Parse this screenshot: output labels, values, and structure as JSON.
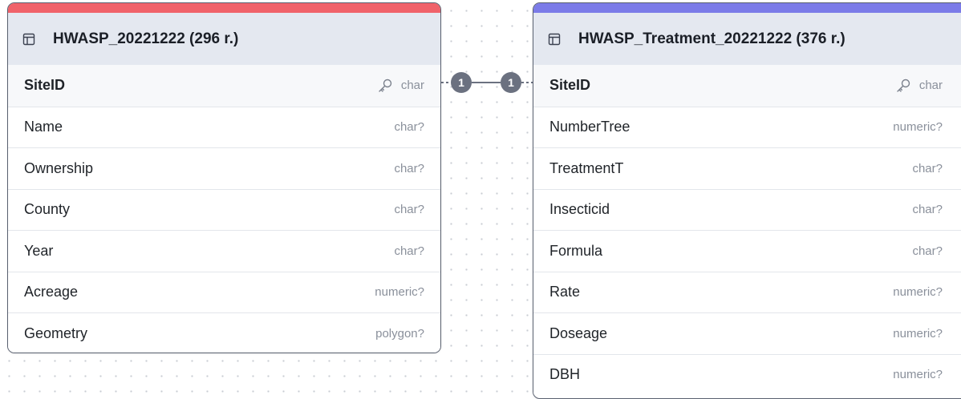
{
  "colors": {
    "left_accent": "#f0626a",
    "right_accent": "#7b7be8",
    "header_bg": "#e4e8f0",
    "connector": "#6b7180"
  },
  "tables": [
    {
      "title": "HWASP_20221222 (296 r.)",
      "icon": "table-icon",
      "columns": [
        {
          "name": "SiteID",
          "type": "char",
          "primary_key": true
        },
        {
          "name": "Name",
          "type": "char?",
          "primary_key": false
        },
        {
          "name": "Ownership",
          "type": "char?",
          "primary_key": false
        },
        {
          "name": "County",
          "type": "char?",
          "primary_key": false
        },
        {
          "name": "Year",
          "type": "char?",
          "primary_key": false
        },
        {
          "name": "Acreage",
          "type": "numeric?",
          "primary_key": false
        },
        {
          "name": "Geometry",
          "type": "polygon?",
          "primary_key": false
        }
      ]
    },
    {
      "title": "HWASP_Treatment_20221222 (376 r.)",
      "icon": "table-icon",
      "columns": [
        {
          "name": "SiteID",
          "type": "char",
          "primary_key": true
        },
        {
          "name": "NumberTree",
          "type": "numeric?",
          "primary_key": false
        },
        {
          "name": "TreatmentT",
          "type": "char?",
          "primary_key": false
        },
        {
          "name": "Insecticid",
          "type": "char?",
          "primary_key": false
        },
        {
          "name": "Formula",
          "type": "char?",
          "primary_key": false
        },
        {
          "name": "Rate",
          "type": "numeric?",
          "primary_key": false
        },
        {
          "name": "Doseage",
          "type": "numeric?",
          "primary_key": false
        },
        {
          "name": "DBH",
          "type": "numeric?",
          "primary_key": false
        }
      ]
    }
  ],
  "relationship": {
    "from_cardinality": "1",
    "to_cardinality": "1"
  }
}
